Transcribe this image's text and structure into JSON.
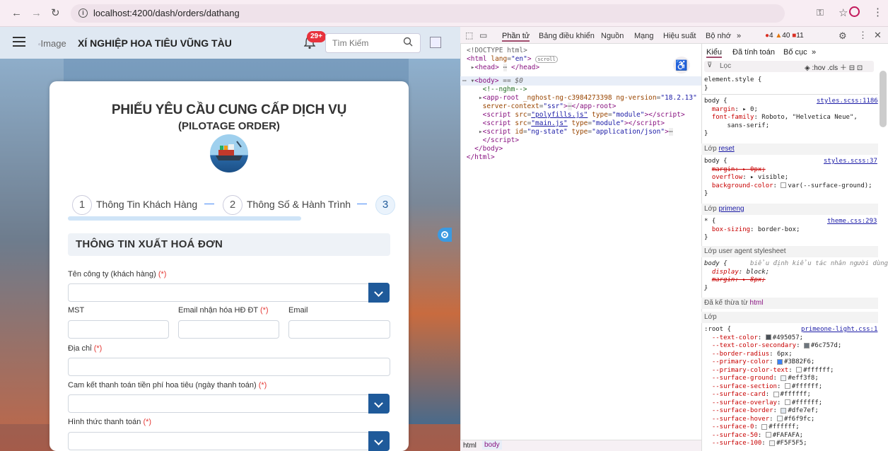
{
  "browser": {
    "url": "localhost:4200/dash/orders/dathang"
  },
  "app": {
    "brand_img_alt": "Image",
    "brand": "XÍ NGHIỆP HOA TIÊU VŨNG TÀU",
    "notif_badge": "29+",
    "search_placeholder": "Tìm Kiếm",
    "title": "PHIẾU YÊU CẦU CUNG CẤP DỊCH VỤ",
    "subtitle": "(PILOTAGE ORDER)",
    "steps": [
      {
        "num": "1",
        "label": "Thông Tin Khách Hàng"
      },
      {
        "num": "2",
        "label": "Thông Số & Hành Trình"
      },
      {
        "num": "3",
        "label": ""
      }
    ],
    "step_sep": "—",
    "section_title": "THÔNG TIN XUẤT HOÁ ĐƠN",
    "required_mark": "(*)",
    "fields": {
      "company": "Tên công ty (khách hàng)",
      "tax": "MST",
      "einvoice_email": "Email nhận hóa HĐ ĐT",
      "email": "Email",
      "address": "Địa chỉ",
      "payment_commit": "Cam kết thanh toán tiền phí hoa tiêu (ngày thanh toán)",
      "payment_method": "Hình thức thanh toán"
    }
  },
  "devtools": {
    "tabs": [
      "Phần tử",
      "Bảng điều khiển",
      "Nguồn",
      "Mạng",
      "Hiệu suất",
      "Bộ nhớ",
      "»"
    ],
    "counts": {
      "errors": "4",
      "warnings": "40",
      "issues": "11"
    },
    "style_tabs": [
      "Kiểu",
      "Đã tính toán",
      "Bố cục",
      "»"
    ],
    "filter_placeholder": "Lọc",
    "hov": ":hov",
    "cls": ".cls",
    "breadcrumbs": [
      "html",
      "body"
    ],
    "layer_reset": "Lớp",
    "layer_reset_link": "reset",
    "layer_primeng": "Lớp",
    "layer_primeng_link": "primeng",
    "layer_ua": "Lớp user agent stylesheet",
    "inherited": "Đã kế thừa từ",
    "inherited_tag": "html",
    "layer_plain": "Lớp",
    "ua_comment": "biểu định kiểu tác nhân người dùng",
    "sources": {
      "styles1": "styles.scss:1186",
      "styles2": "styles.scss:37",
      "theme": "theme.css:293",
      "primeone": "primeone-light.css:1"
    }
  }
}
